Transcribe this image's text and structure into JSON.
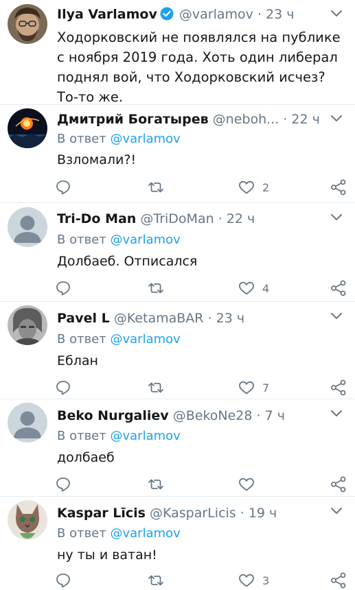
{
  "main_tweet": {
    "name": "Ilya Varlamov",
    "handle": "@varlamov",
    "separator": "·",
    "time": "23 ч",
    "text": "Ходорковский не появлялся на публике с ноября 2019 года. Хоть один либерал поднял вой, что Ходорковский исчез? То-то же."
  },
  "reply_prefix": "В ответ",
  "reply_mention": "@varlamov",
  "replies": [
    {
      "name": "Дмитрий Богатырев",
      "handle": "@neboh...",
      "separator": "·",
      "time": "22 ч",
      "text": "Взломали?!",
      "likes": "2"
    },
    {
      "name": "Tri-Do Man",
      "handle": "@TriDoMan",
      "separator": "·",
      "time": "22 ч",
      "text": "Долбаеб. Отписался",
      "likes": "4"
    },
    {
      "name": "Pavel L",
      "handle": "@KetamaBAR",
      "separator": "·",
      "time": "23 ч",
      "text": "Еблан",
      "likes": "7"
    },
    {
      "name": "Beko Nurgaliev",
      "handle": "@BekoNe28",
      "separator": "·",
      "time": "7 ч",
      "text": "долбаеб",
      "likes": ""
    },
    {
      "name": "Kaspar Līcis",
      "handle": "@KasparLicis",
      "separator": "·",
      "time": "19 ч",
      "text": "ну ты и ватан!",
      "likes": "3"
    }
  ],
  "colors": {
    "accent": "#1da1f2",
    "muted": "#657786",
    "text": "#14171a",
    "divider": "#e6ecf0"
  },
  "icons": [
    "reply-icon",
    "retweet-icon",
    "like-icon",
    "share-icon",
    "caret-down-icon",
    "verified-badge-icon"
  ]
}
